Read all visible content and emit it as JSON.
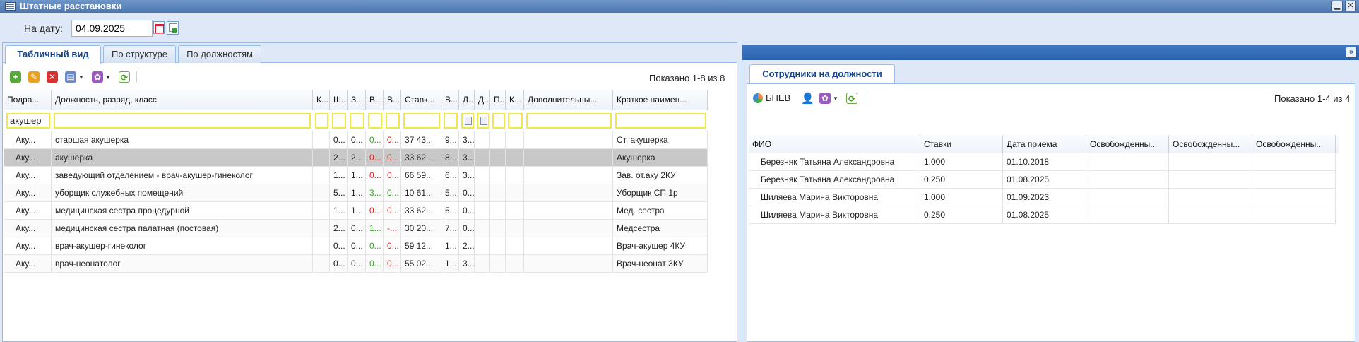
{
  "window": {
    "title": "Штатные расстановки"
  },
  "datebar": {
    "label": "На дату:",
    "date": "04.09.2025"
  },
  "tabs": [
    {
      "label": "Табличный вид",
      "active": true
    },
    {
      "label": "По структуре",
      "active": false
    },
    {
      "label": "По должностям",
      "active": false
    }
  ],
  "toolbar": {
    "add_icon": "add-icon",
    "edit_icon": "pencil-icon",
    "delete_icon": "delete-icon",
    "print_icon": "printer-icon",
    "actions_icon": "gear-icon",
    "refresh_icon": "refresh-icon",
    "shown": "Показано 1-8 из 8"
  },
  "positions_grid": {
    "columns": [
      "Подра...",
      "Должность, разряд, класс",
      "К...",
      "Ш...",
      "З...",
      "В...",
      "В...",
      "Ставк...",
      "В...",
      "Д...",
      "Д...",
      "П...",
      "К...",
      "Дополнительны...",
      "Краткое наимен..."
    ],
    "filters": {
      "dept": "акушер",
      "position": "",
      "col2": "",
      "col3": "",
      "col4": "",
      "col5": "",
      "col6": "",
      "col7": "",
      "col8": "",
      "col11": "",
      "col12": "",
      "col13": "",
      "short": ""
    },
    "rows": [
      {
        "dept": "Аку...",
        "position": "старшая акушерка",
        "c2": "",
        "c3": "0...",
        "c4": "0...",
        "c5": "0...",
        "c5color": "green",
        "c6": "0...",
        "c6color": "red",
        "rate": "37 43...",
        "c8": "9...",
        "c9": "3...",
        "c10": "",
        "c11": "",
        "c12": "",
        "c13": "",
        "extra": "",
        "short": "Ст. акушерка",
        "selected": false
      },
      {
        "dept": "Аку...",
        "position": "акушерка",
        "c2": "",
        "c3": "2...",
        "c4": "2...",
        "c5": "0...",
        "c5color": "red",
        "c6": "0...",
        "c6color": "red",
        "rate": "33 62...",
        "c8": "8...",
        "c9": "3...",
        "c10": "",
        "c11": "",
        "c12": "",
        "c13": "",
        "extra": "",
        "short": "Акушерка",
        "selected": true
      },
      {
        "dept": "Аку...",
        "position": "заведующий отделением - врач-акушер-гинеколог",
        "c2": "",
        "c3": "1...",
        "c4": "1...",
        "c5": "0...",
        "c5color": "red",
        "c6": "0...",
        "c6color": "red",
        "rate": "66 59...",
        "c8": "6...",
        "c9": "3...",
        "c10": "",
        "c11": "",
        "c12": "",
        "c13": "",
        "extra": "",
        "short": "Зав. от.аку 2КУ",
        "selected": false
      },
      {
        "dept": "Аку...",
        "position": "уборщик служебных помещений",
        "c2": "",
        "c3": "5...",
        "c4": "1...",
        "c5": "3...",
        "c5color": "green",
        "c6": "0...",
        "c6color": "green",
        "rate": "10 61...",
        "c8": "5...",
        "c9": "0...",
        "c10": "",
        "c11": "",
        "c12": "",
        "c13": "",
        "extra": "",
        "short": "Уборщик СП 1р",
        "selected": false
      },
      {
        "dept": "Аку...",
        "position": "медицинская сестра процедурной",
        "c2": "",
        "c3": "1...",
        "c4": "1...",
        "c5": "0...",
        "c5color": "red",
        "c6": "0...",
        "c6color": "red",
        "rate": "33 62...",
        "c8": "5...",
        "c9": "0...",
        "c10": "",
        "c11": "",
        "c12": "",
        "c13": "",
        "extra": "",
        "short": "Мед. сестра",
        "selected": false
      },
      {
        "dept": "Аку...",
        "position": "медицинская сестра палатная (постовая)",
        "c2": "",
        "c3": "2...",
        "c4": "0...",
        "c5": "1...",
        "c5color": "green",
        "c6": "-...",
        "c6color": "red",
        "rate": "30 20...",
        "c8": "7...",
        "c9": "0...",
        "c10": "",
        "c11": "",
        "c12": "",
        "c13": "",
        "extra": "",
        "short": "Медсестра",
        "selected": false
      },
      {
        "dept": "Аку...",
        "position": "врач-акушер-гинеколог",
        "c2": "",
        "c3": "0...",
        "c4": "0...",
        "c5": "0...",
        "c5color": "green",
        "c6": "0...",
        "c6color": "red",
        "rate": "59 12...",
        "c8": "1...",
        "c9": "2...",
        "c10": "",
        "c11": "",
        "c12": "",
        "c13": "",
        "extra": "",
        "short": "Врач-акушер 4КУ",
        "selected": false
      },
      {
        "dept": "Аку...",
        "position": "врач-неонатолог",
        "c2": "",
        "c3": "0...",
        "c4": "0...",
        "c5": "0...",
        "c5color": "green",
        "c6": "0...",
        "c6color": "red",
        "rate": "55 02...",
        "c8": "1...",
        "c9": "3...",
        "c10": "",
        "c11": "",
        "c12": "",
        "c13": "",
        "extra": "",
        "short": "Врач-неонат 3КУ",
        "selected": false
      }
    ]
  },
  "employees_panel": {
    "tab": "Сотрудники на должности",
    "bnev_label": "БНЕВ",
    "bnev_icon": "chart-icon",
    "person_icon": "person-icon",
    "actions_icon": "gear-icon",
    "refresh_icon": "refresh-icon",
    "shown": "Показано 1-4 из 4",
    "columns": [
      "ФИО",
      "Ставки",
      "Дата приема",
      "Освобожденны...",
      "Освобожденны...",
      "Освобожденны..."
    ],
    "rows": [
      {
        "fio": "Березняк Татьяна Александровна",
        "rate": "1.000",
        "date": "01.10.2018",
        "f1": "",
        "f2": "",
        "f3": ""
      },
      {
        "fio": "Березняк Татьяна Александровна",
        "rate": "0.250",
        "date": "01.08.2025",
        "f1": "",
        "f2": "",
        "f3": ""
      },
      {
        "fio": "Шиляева Марина Викторовна",
        "rate": "1.000",
        "date": "01.09.2023",
        "f1": "",
        "f2": "",
        "f3": ""
      },
      {
        "fio": "Шиляева Марина Викторовна",
        "rate": "0.250",
        "date": "01.08.2025",
        "f1": "",
        "f2": "",
        "f3": ""
      }
    ]
  },
  "colors": {
    "accent": "#2d64b0",
    "filter_border": "#f0e84a",
    "positive": "#3aa12a",
    "negative": "#e02020",
    "selected_row": "#c8c8c8"
  }
}
